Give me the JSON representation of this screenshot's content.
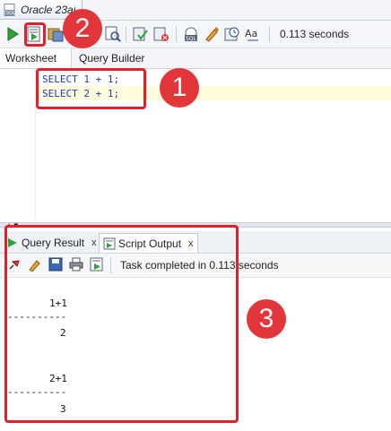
{
  "window": {
    "tab_title": "Oracle 23ai"
  },
  "toolbar": {
    "timing": "0.113 seconds",
    "icons": [
      "run-statement-icon",
      "run-script-icon",
      "autotrace-icon",
      "explain-plan-icon",
      "sql-tuning-icon",
      "commit-icon",
      "rollback-icon",
      "sql-format-icon",
      "clear-icon",
      "history-icon",
      "case-icon"
    ]
  },
  "tabs": {
    "worksheet": "Worksheet",
    "query_builder": "Query Builder"
  },
  "editor": {
    "lines": [
      "SELECT 1 + 1;",
      "SELECT 2 + 1;"
    ]
  },
  "output": {
    "tabs": [
      {
        "label": "Query Result",
        "close": "x"
      },
      {
        "label": "Script Output",
        "close": "x"
      }
    ],
    "status": "Task completed in 0.113 seconds",
    "results": [
      {
        "header": "1+1",
        "separator": "----------",
        "value": "2"
      },
      {
        "header": "2+1",
        "separator": "----------",
        "value": "3"
      }
    ]
  },
  "annotations": {
    "one": "1",
    "two": "2",
    "three": "3"
  },
  "colors": {
    "annotation_red": "#e0212b",
    "badge_red": "#e2363a",
    "sql_keyword": "#1c3cb8"
  }
}
